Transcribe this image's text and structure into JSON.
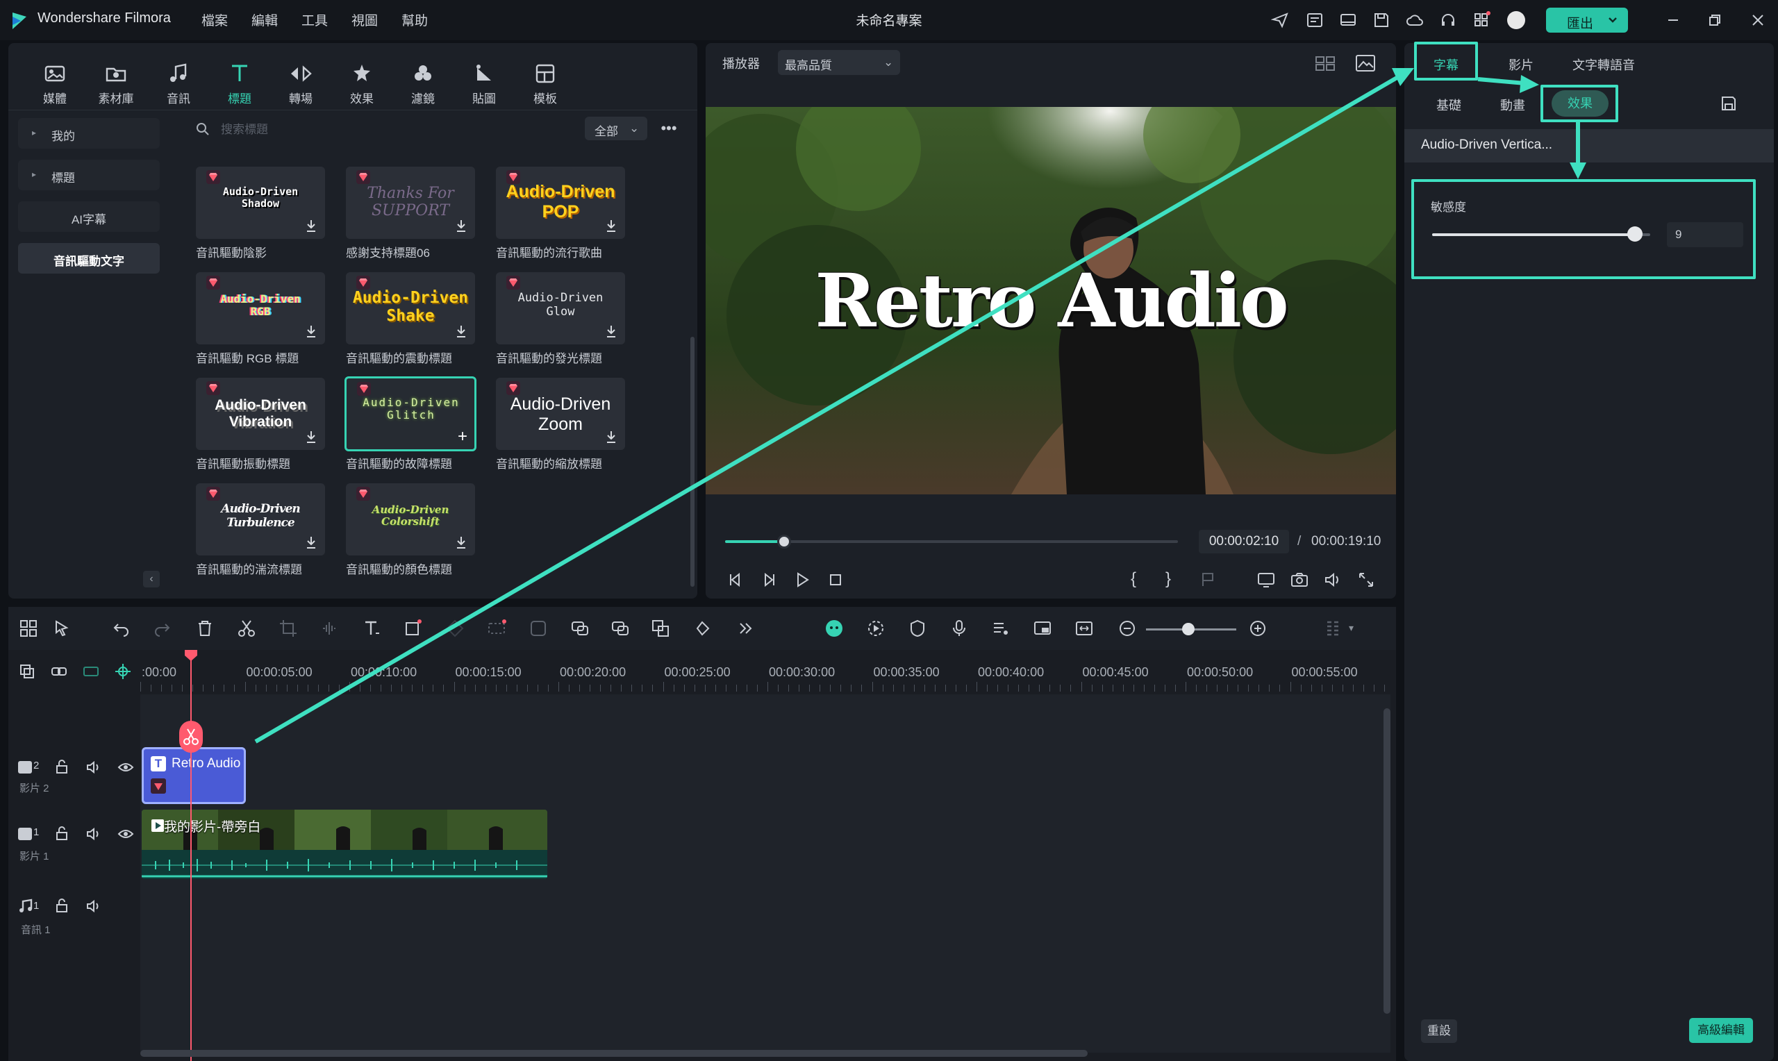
{
  "app": {
    "name": "Wondershare Filmora",
    "project_title": "未命名專案",
    "menu": [
      "檔案",
      "編輯",
      "工具",
      "視圖",
      "幫助"
    ],
    "export_label": "匯出",
    "accent_color": "#29c4a6",
    "titlebar_icons": [
      "send-icon",
      "list-icon",
      "monitor-icon",
      "save-icon",
      "cloud-icon",
      "headset-icon",
      "grid-icon",
      "avatar"
    ]
  },
  "library": {
    "tabs": [
      {
        "label": "媒體",
        "icon": "media-icon"
      },
      {
        "label": "素材庫",
        "icon": "stock-icon"
      },
      {
        "label": "音訊",
        "icon": "music-icon"
      },
      {
        "label": "標題",
        "icon": "title-icon",
        "active": true
      },
      {
        "label": "轉場",
        "icon": "transition-icon"
      },
      {
        "label": "效果",
        "icon": "effects-icon"
      },
      {
        "label": "濾鏡",
        "icon": "filters-icon"
      },
      {
        "label": "貼圖",
        "icon": "stickers-icon"
      },
      {
        "label": "模板",
        "icon": "templates-icon"
      }
    ],
    "sidebar": [
      {
        "label": "我的",
        "expandable": true
      },
      {
        "label": "標題",
        "expandable": true
      },
      {
        "label": "AI字幕",
        "expandable": false
      },
      {
        "label": "音訊驅動文字",
        "expandable": false,
        "active": true
      }
    ],
    "search_placeholder": "搜索標題",
    "filter_value": "全部",
    "templates": [
      {
        "caption": "音訊驅動陰影",
        "preview": "Audio-Driven\nShadow"
      },
      {
        "caption": "感謝支持標題06",
        "preview": "Thanks For\nSUPPORT"
      },
      {
        "caption": "音訊驅動的流行歌曲",
        "preview": "Audio-Driven\nPOP"
      },
      {
        "caption": "音訊驅動 RGB 標題",
        "preview": "Audio-Driven\nRGB"
      },
      {
        "caption": "音訊驅動的震動標題",
        "preview": "Audio-Driven\nShake"
      },
      {
        "caption": "音訊驅動的發光標題",
        "preview": "Audio-Driven\nGlow"
      },
      {
        "caption": "音訊驅動振動標題",
        "preview": "Audio-Driven\nVibration"
      },
      {
        "caption": "音訊驅動的故障標題",
        "preview": "Audio-Driven\nGlitch",
        "selected": true
      },
      {
        "caption": "音訊驅動的縮放標題",
        "preview": "Audio-Driven\nZoom"
      },
      {
        "caption": "音訊驅動的湍流標題",
        "preview": "Audio-Driven\nTurbulence"
      },
      {
        "caption": "音訊驅動的顏色標題",
        "preview": "Audio-Driven\nColorshift"
      }
    ]
  },
  "player": {
    "label": "播放器",
    "quality": "最高品質",
    "video_title_text": "Retro Audio",
    "progress": 0.13,
    "current_time": "00:00:02:10",
    "total_time": "00:00:19:10"
  },
  "inspector": {
    "tabs": [
      {
        "label": "字幕",
        "active": true
      },
      {
        "label": "影片"
      },
      {
        "label": "文字轉語音"
      }
    ],
    "subtabs": [
      {
        "label": "基礎"
      },
      {
        "label": "動畫"
      },
      {
        "label": "效果",
        "active": true
      }
    ],
    "effect_name": "Audio-Driven Vertica...",
    "sensitivity_label": "敏感度",
    "sensitivity_value": "9",
    "sensitivity_fraction": 0.93,
    "reset_label": "重設",
    "advanced_label": "高級編輯"
  },
  "timeline": {
    "ruler_labels": [
      ":00:00",
      "00:00:05:00",
      "00:00:10:00",
      "00:00:15:00",
      "00:00:20:00",
      "00:00:25:00",
      "00:00:30:00",
      "00:00:35:00",
      "00:00:40:00",
      "00:00:45:00",
      "00:00:50:00",
      "00:00:55:00"
    ],
    "tracks": [
      {
        "num": "2",
        "name": "影片 2"
      },
      {
        "num": "1",
        "name": "影片 1"
      },
      {
        "num": "1",
        "name": "音訊 1"
      }
    ],
    "title_clip_label": "Retro Audio",
    "video_clip_label": "我的影片-帶旁白"
  }
}
